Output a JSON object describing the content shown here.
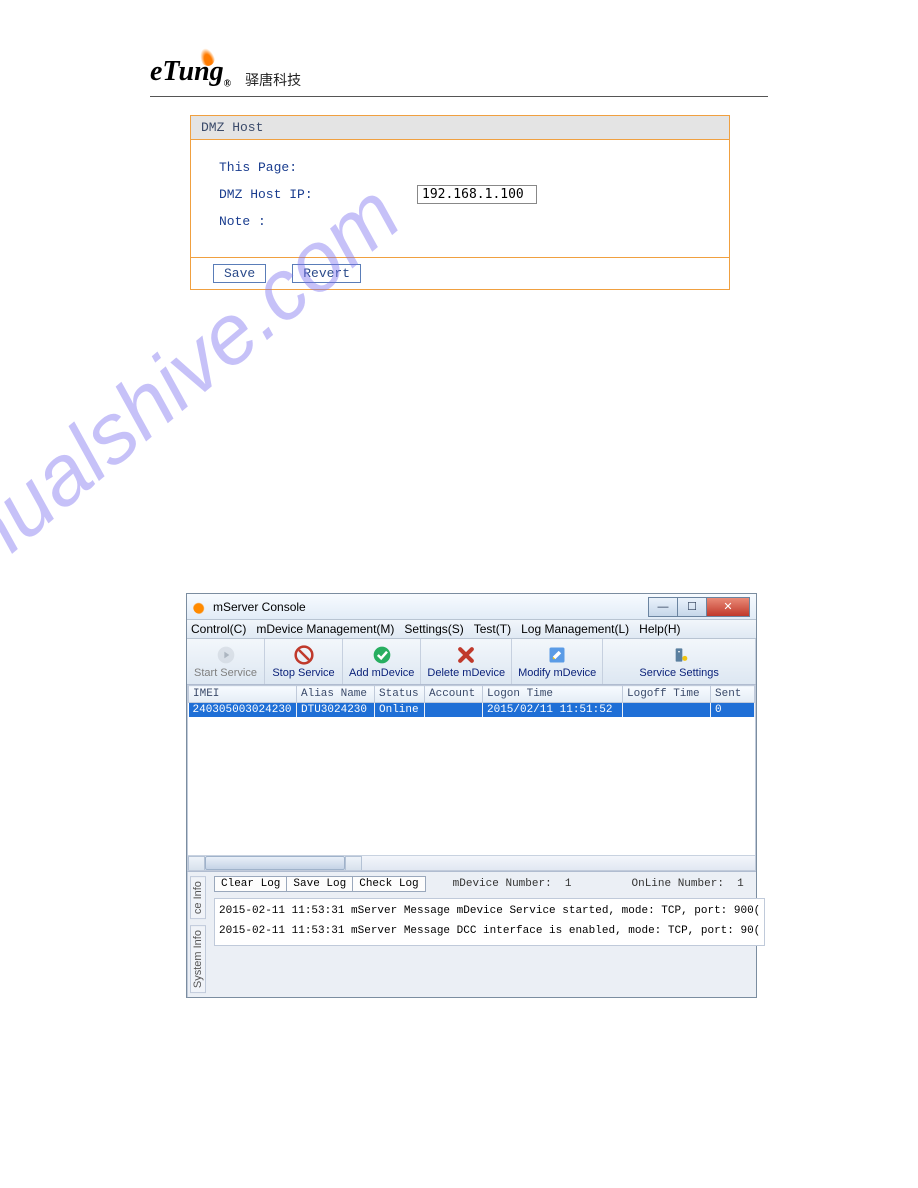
{
  "header": {
    "logo_text": "eTung",
    "logo_reg": "®",
    "subtitle": "驿唐科技"
  },
  "dmz": {
    "panel_title": "DMZ Host",
    "this_page_label": "This Page:",
    "ip_label": "DMZ Host IP:",
    "ip_value": "192.168.1.100",
    "note_label": "Note :",
    "save_label": "Save",
    "revert_label": "Revert"
  },
  "watermark": "manualshive.com",
  "console": {
    "title": "mServer Console",
    "menus": {
      "control": "Control(C)",
      "mdevice_mgmt": "mDevice Management(M)",
      "settings": "Settings(S)",
      "test": "Test(T)",
      "log_mgmt": "Log Management(L)",
      "help": "Help(H)"
    },
    "toolbar": {
      "start_service": "Start Service",
      "stop_service": "Stop Service",
      "add_mdevice": "Add mDevice",
      "delete_mdevice": "Delete mDevice",
      "modify_mdevice": "Modify mDevice",
      "service_settings": "Service Settings"
    },
    "table": {
      "headers": {
        "imei": "IMEI",
        "alias_name": "Alias Name",
        "status": "Status",
        "account": "Account",
        "logon_time": "Logon Time",
        "logoff_time": "Logoff Time",
        "sent": "Sent"
      },
      "rows": [
        {
          "imei": "240305003024230",
          "alias_name": "DTU3024230",
          "status": "Online",
          "account": "",
          "logon_time": "2015/02/11 11:51:52",
          "logoff_time": "",
          "sent": "0"
        }
      ]
    },
    "bottom": {
      "tabs": {
        "system_info": "System Info",
        "ice_info": "ce Info"
      },
      "buttons": {
        "clear": "Clear Log",
        "save": "Save Log",
        "check": "Check Log"
      },
      "mdevice_number_label": "mDevice Number:",
      "mdevice_number_value": "1",
      "online_number_label": "OnLine Number:",
      "online_number_value": "1",
      "log_lines": [
        "2015-02-11 11:53:31    mServer Message mDevice Service started, mode: TCP, port: 900(",
        "2015-02-11 11:53:31    mServer Message DCC interface is enabled, mode: TCP, port: 90("
      ]
    }
  }
}
